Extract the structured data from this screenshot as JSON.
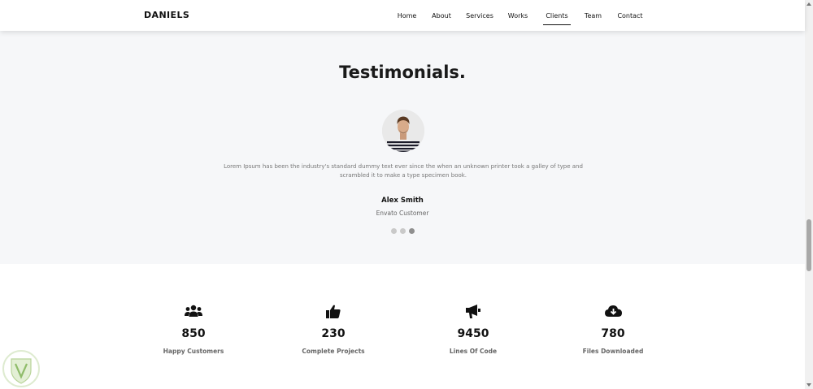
{
  "navbar": {
    "brand": "DANIELS",
    "items": [
      {
        "label": "Home",
        "active": false
      },
      {
        "label": "About",
        "active": false
      },
      {
        "label": "Services",
        "active": false
      },
      {
        "label": "Works",
        "active": false
      },
      {
        "label": "Clients",
        "active": true
      },
      {
        "label": "Team",
        "active": false
      },
      {
        "label": "Contact",
        "active": false
      }
    ]
  },
  "testimonials": {
    "title": "Testimonials.",
    "quote": "Lorem Ipsum has been the industry's standard dummy text ever since the when an unknown printer took a galley of type and scrambled it to make a type specimen book.",
    "name": "Alex Smith",
    "role": "Envato Customer",
    "slides_total": 3,
    "active_slide": 3
  },
  "stats": [
    {
      "icon": "users-icon",
      "value": "850",
      "label": "Happy Customers"
    },
    {
      "icon": "thumbs-up-icon",
      "value": "230",
      "label": "Complete Projects"
    },
    {
      "icon": "megaphone-icon",
      "value": "9450",
      "label": "Lines Of Code"
    },
    {
      "icon": "cloud-download-icon",
      "value": "780",
      "label": "Files Downloaded"
    }
  ],
  "colors": {
    "section_bg": "#f6f7f9",
    "text_dark": "#111111",
    "text_muted": "#777777",
    "dot_inactive": "#c9c9c9",
    "dot_active": "#8f8f8f"
  }
}
